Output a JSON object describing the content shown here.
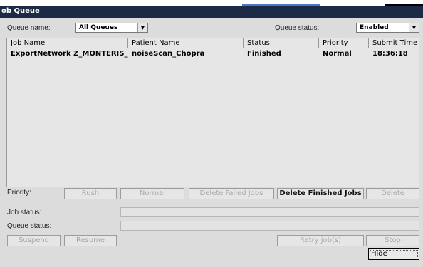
{
  "window": {
    "title": "ob Queue"
  },
  "filters": {
    "queue_name_label": "Queue name:",
    "queue_name_value": "All Queues",
    "queue_status_label": "Queue status:",
    "queue_status_value": "Enabled"
  },
  "table": {
    "columns": [
      "Job Name",
      "Patient Name",
      "Status",
      "Priority",
      "Submit Time"
    ],
    "rows": [
      [
        "ExportNetwork Z_MONTERIS_RTT",
        "noiseScan_Chopra",
        "Finished",
        "Normal",
        "18:36:18"
      ]
    ]
  },
  "priority_row": {
    "label": "Priority:",
    "rush": "Rush",
    "normal": "Normal",
    "delete_failed": "Delete Failed Jobs",
    "delete_finished": "Delete Finished Jobs",
    "delete": "Delete"
  },
  "status_rows": {
    "job_status_label": "Job status:",
    "queue_status_label": "Queue status:"
  },
  "controls": {
    "suspend": "Suspend",
    "resume": "Resume",
    "retry": "Retry job(s)",
    "stop": "Stop",
    "hide": "Hide"
  },
  "icons": {
    "dropdown": "chevron-down-icon"
  },
  "colors": {
    "titlebar": "#1c2a45",
    "panel": "#dcdcdc",
    "accent": "#4a78c8"
  }
}
